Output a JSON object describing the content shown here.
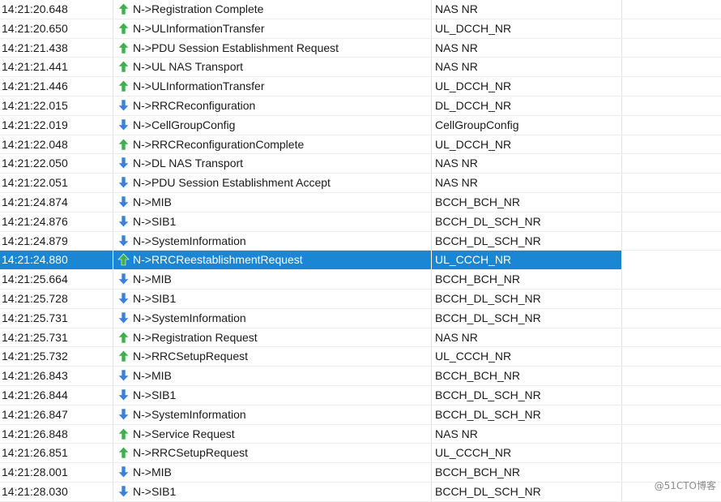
{
  "colors": {
    "uplink_arrow": "#3fb04d",
    "downlink_arrow": "#3d7fd9",
    "selected_row": "#1a86d4"
  },
  "rows": [
    {
      "time": "14:21:20.648",
      "dir": "up",
      "message": "N->Registration Complete",
      "channel": "NAS NR"
    },
    {
      "time": "14:21:20.650",
      "dir": "up",
      "message": "N->ULInformationTransfer",
      "channel": "UL_DCCH_NR"
    },
    {
      "time": "14:21:21.438",
      "dir": "up",
      "message": "N->PDU Session Establishment Request",
      "channel": "NAS NR"
    },
    {
      "time": "14:21:21.441",
      "dir": "up",
      "message": "N->UL NAS Transport",
      "channel": "NAS NR"
    },
    {
      "time": "14:21:21.446",
      "dir": "up",
      "message": "N->ULInformationTransfer",
      "channel": "UL_DCCH_NR"
    },
    {
      "time": "14:21:22.015",
      "dir": "down",
      "message": "N->RRCReconfiguration",
      "channel": "DL_DCCH_NR"
    },
    {
      "time": "14:21:22.019",
      "dir": "down",
      "message": "N->CellGroupConfig",
      "channel": "CellGroupConfig"
    },
    {
      "time": "14:21:22.048",
      "dir": "up",
      "message": "N->RRCReconfigurationComplete",
      "channel": "UL_DCCH_NR"
    },
    {
      "time": "14:21:22.050",
      "dir": "down",
      "message": "N->DL NAS Transport",
      "channel": "NAS NR"
    },
    {
      "time": "14:21:22.051",
      "dir": "down",
      "message": "N->PDU Session Establishment Accept",
      "channel": "NAS NR"
    },
    {
      "time": "14:21:24.874",
      "dir": "down",
      "message": "N->MIB",
      "channel": "BCCH_BCH_NR"
    },
    {
      "time": "14:21:24.876",
      "dir": "down",
      "message": "N->SIB1",
      "channel": "BCCH_DL_SCH_NR"
    },
    {
      "time": "14:21:24.879",
      "dir": "down",
      "message": "N->SystemInformation",
      "channel": "BCCH_DL_SCH_NR"
    },
    {
      "time": "14:21:24.880",
      "dir": "up",
      "message": "N->RRCReestablishmentRequest",
      "channel": "UL_CCCH_NR",
      "selected": true
    },
    {
      "time": "14:21:25.664",
      "dir": "down",
      "message": "N->MIB",
      "channel": "BCCH_BCH_NR"
    },
    {
      "time": "14:21:25.728",
      "dir": "down",
      "message": "N->SIB1",
      "channel": "BCCH_DL_SCH_NR"
    },
    {
      "time": "14:21:25.731",
      "dir": "down",
      "message": "N->SystemInformation",
      "channel": "BCCH_DL_SCH_NR"
    },
    {
      "time": "14:21:25.731",
      "dir": "up",
      "message": "N->Registration Request",
      "channel": "NAS NR"
    },
    {
      "time": "14:21:25.732",
      "dir": "up",
      "message": "N->RRCSetupRequest",
      "channel": "UL_CCCH_NR"
    },
    {
      "time": "14:21:26.843",
      "dir": "down",
      "message": "N->MIB",
      "channel": "BCCH_BCH_NR"
    },
    {
      "time": "14:21:26.844",
      "dir": "down",
      "message": "N->SIB1",
      "channel": "BCCH_DL_SCH_NR"
    },
    {
      "time": "14:21:26.847",
      "dir": "down",
      "message": "N->SystemInformation",
      "channel": "BCCH_DL_SCH_NR"
    },
    {
      "time": "14:21:26.848",
      "dir": "up",
      "message": "N->Service Request",
      "channel": "NAS NR"
    },
    {
      "time": "14:21:26.851",
      "dir": "up",
      "message": "N->RRCSetupRequest",
      "channel": "UL_CCCH_NR"
    },
    {
      "time": "14:21:28.001",
      "dir": "down",
      "message": "N->MIB",
      "channel": "BCCH_BCH_NR"
    },
    {
      "time": "14:21:28.030",
      "dir": "down",
      "message": "N->SIB1",
      "channel": "BCCH_DL_SCH_NR"
    }
  ],
  "watermark": "@51CTO博客"
}
